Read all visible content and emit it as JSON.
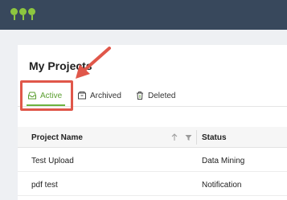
{
  "header": {
    "logo_icon": "app-logo-icon"
  },
  "page": {
    "title": "My Projects"
  },
  "tabs": [
    {
      "label": "Active",
      "icon": "inbox-icon",
      "active": true
    },
    {
      "label": "Archived",
      "icon": "archive-icon",
      "active": false
    },
    {
      "label": "Deleted",
      "icon": "trash-icon",
      "active": false
    }
  ],
  "table": {
    "columns": [
      {
        "label": "Project Name",
        "sortable": true,
        "filterable": true
      },
      {
        "label": "Status"
      }
    ],
    "rows": [
      {
        "name": "Test Upload",
        "status": "Data Mining"
      },
      {
        "name": "pdf test",
        "status": "Notification"
      }
    ]
  },
  "colors": {
    "accent": "#6db33f",
    "header_bg": "#38485c",
    "highlight": "#e0574a"
  }
}
